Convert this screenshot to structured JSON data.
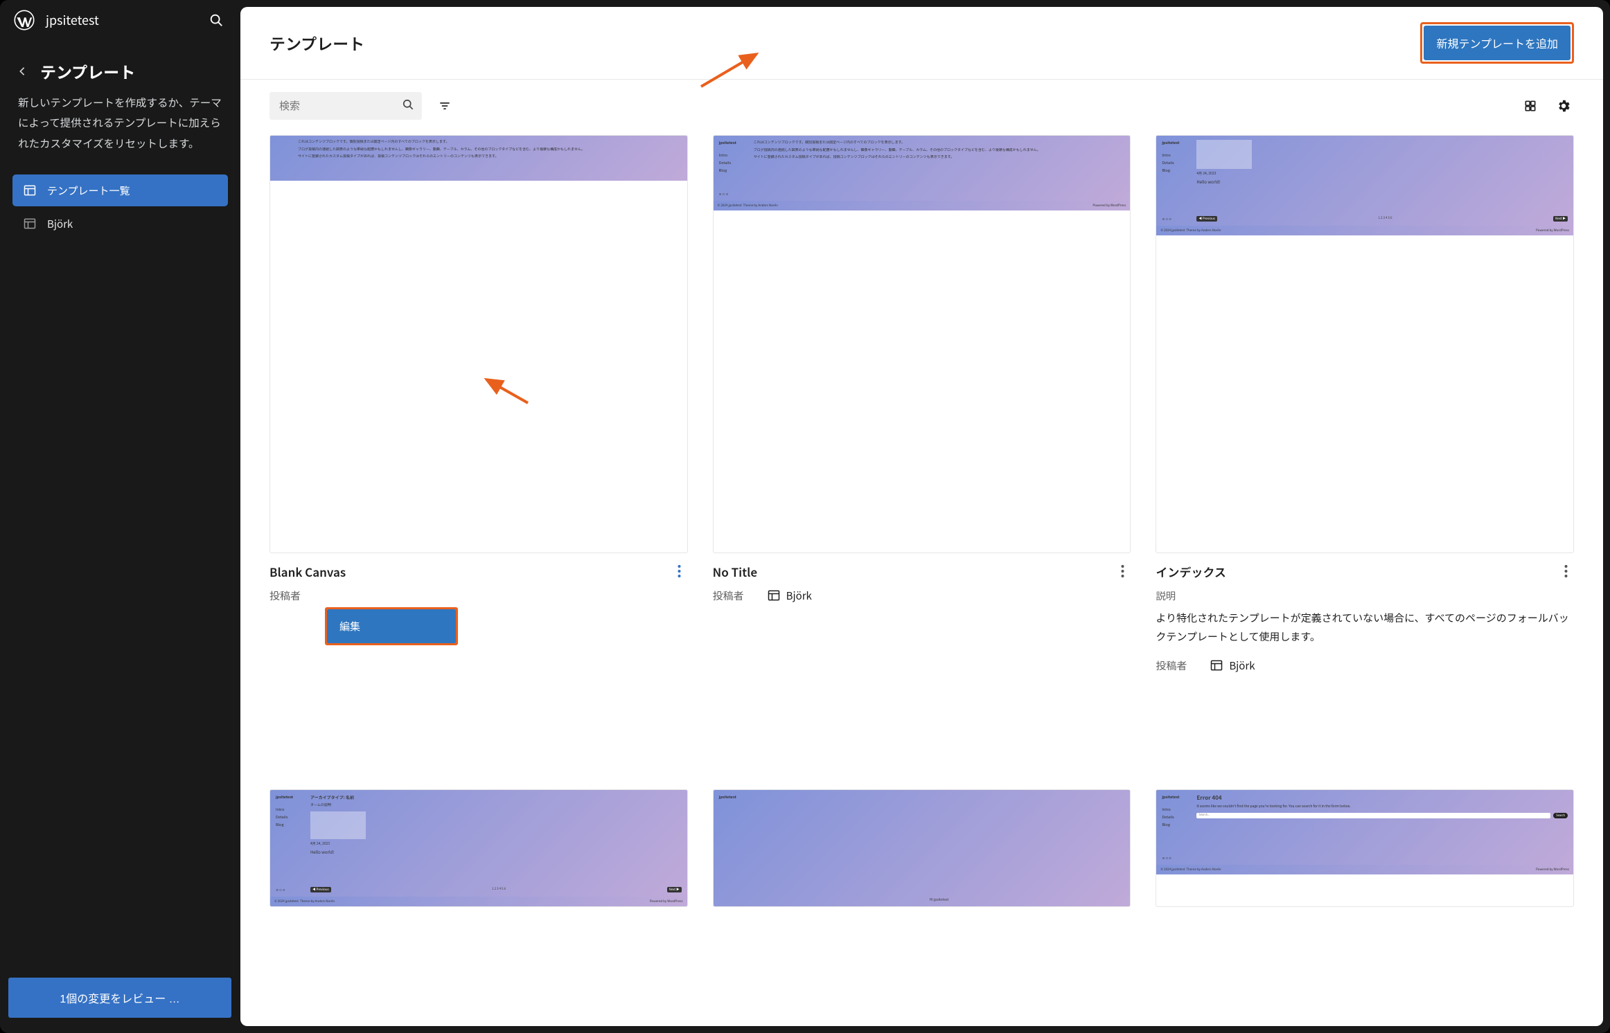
{
  "site": {
    "title": "jpsitetest"
  },
  "sidebar": {
    "heading": "テンプレート",
    "description": "新しいテンプレートを作成するか、テーマによって提供されるテンプレートに加えられたカスタマイズをリセットします。",
    "items": [
      {
        "label": "テンプレート一覧"
      },
      {
        "label": "Björk"
      }
    ],
    "review_button": "1個の変更をレビュー …"
  },
  "main": {
    "title": "テンプレート",
    "add_button": "新規テンプレートを追加",
    "search_placeholder": "検索",
    "cards": [
      {
        "title": "Blank Canvas",
        "author_label": "投稿者",
        "edit_label": "編集"
      },
      {
        "title": "No Title",
        "author_label": "投稿者",
        "author_name": "Björk"
      },
      {
        "title": "インデックス",
        "desc_label": "説明",
        "desc_text": "より特化されたテンプレートが定義されていない場合に、すべてのページのフォールバックテンプレートとして使用します。",
        "author_label": "投稿者",
        "author_name": "Björk"
      }
    ]
  },
  "preview_strings": {
    "sitename": "jpsitetest",
    "nav_intro": "Intro",
    "nav_details": "Details",
    "nav_blog": "Blog",
    "date": "4月 24, 2023",
    "hello": "Hello world!",
    "error": "Error 404",
    "error_sub": "It seems like we couldn't find the page you're looking for. You can search for it in the form below.",
    "search": "Search...",
    "search_btn": "Search",
    "copyright": "© 2024  jpsitetest",
    "theme": "Theme by Anders Norén",
    "powered": "Powered by WordPress",
    "archive": "アーカイブタイプ: 名前",
    "archive_sub": "タームの説明",
    "prev": "Previous",
    "next": "Next"
  }
}
